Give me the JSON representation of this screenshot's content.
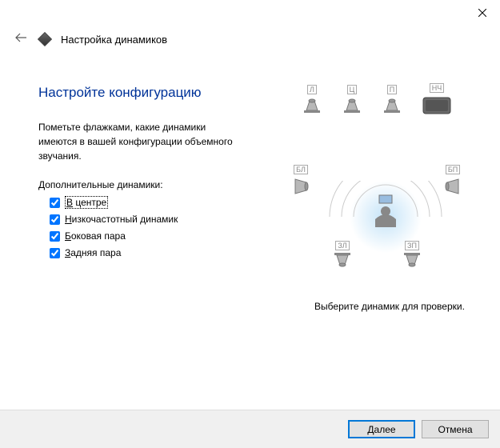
{
  "header": {
    "title": "Настройка динамиков"
  },
  "page": {
    "title": "Настройте конфигурацию",
    "instruction": "Пометьте флажками, какие динамики имеются в вашей конфигурации объемного звучания.",
    "section_label": "Дополнительные динамики:"
  },
  "options": [
    {
      "label": "В центре",
      "accel": "В",
      "checked": true,
      "focused": true
    },
    {
      "label": "Низкочастотный динамик",
      "accel": "Н",
      "checked": true,
      "focused": false
    },
    {
      "label": "Боковая пара",
      "accel": "Б",
      "checked": true,
      "focused": false
    },
    {
      "label": "Задняя пара",
      "accel": "З",
      "checked": true,
      "focused": false
    }
  ],
  "speakers": {
    "front_left": "Л",
    "front_center": "Ц",
    "front_right": "П",
    "subwoofer": "НЧ",
    "side_left": "БЛ",
    "side_right": "БП",
    "rear_left": "ЗЛ",
    "rear_right": "ЗП"
  },
  "hint": "Выберите динамик для проверки.",
  "footer": {
    "next": "Далее",
    "cancel": "Отмена"
  }
}
